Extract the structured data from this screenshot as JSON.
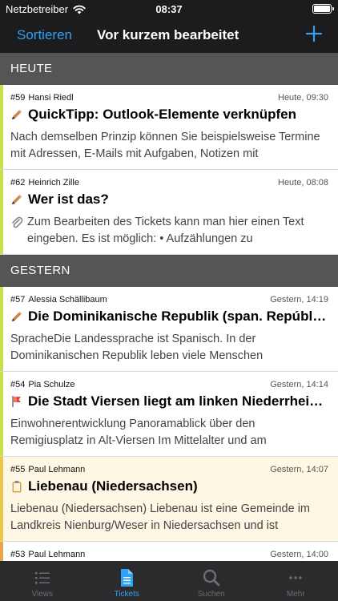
{
  "status": {
    "carrier": "Netzbetreiber",
    "time": "08:37"
  },
  "nav": {
    "sort_label": "Sortieren",
    "title": "Vor kurzem bearbeitet"
  },
  "sections": [
    {
      "label": "HEUTE"
    },
    {
      "label": "GESTERN"
    }
  ],
  "tickets": [
    {
      "number": "#59",
      "author": "Hansi Riedl",
      "timestamp": "Heute, 09:30",
      "title": "QuickTipp: Outlook-Elemente verknüpfen",
      "description": "Nach demselben Prinzip können Sie beispielsweise Termine mit Adressen, E-Mails mit Aufgaben, Notizen mit",
      "icon": "pencil-icon",
      "stripe": "#c8e04a"
    },
    {
      "number": "#62",
      "author": "Heinrich Zille",
      "timestamp": "Heute, 08:08",
      "title": "Wer ist das?",
      "description": "Zum Bearbeiten des Tickets kann man hier einen Text eingeben. Es ist möglich: • Aufzählungen zu",
      "icon": "pencil-icon",
      "stripe": "#c8e04a",
      "attachment": true
    },
    {
      "number": "#57",
      "author": "Alessia Schällibaum",
      "timestamp": "Gestern, 14:19",
      "title": "Die Dominikanische Republik (span. Repúbli…",
      "description": "SpracheDie Landessprache ist Spanisch. In der Dominikanischen Republik leben viele Menschen",
      "icon": "pencil-icon",
      "stripe": "#c8e04a"
    },
    {
      "number": "#54",
      "author": "Pia Schulze",
      "timestamp": "Gestern, 14:14",
      "title": "Die Stadt Viersen liegt am linken Niederrhei…",
      "description": "Einwohnerentwicklung Panoramablick über den Remigiusplatz in Alt-Viersen Im Mittelalter und am",
      "icon": "flag-icon",
      "stripe": "#c8e04a"
    },
    {
      "number": "#55",
      "author": "Paul Lehmann",
      "timestamp": "Gestern, 14:07",
      "title": "Liebenau (Niedersachsen)",
      "description": "Liebenau (Niedersachsen) Liebenau ist eine Gemeinde im Landkreis Nienburg/Weser in Niedersachsen und ist",
      "icon": "clipboard-icon",
      "stripe": "#e8c84a",
      "highlight": true
    },
    {
      "number": "#53",
      "author": "Paul Lehmann",
      "timestamp": "Gestern, 14:00",
      "title": "",
      "description": "",
      "icon": "",
      "stripe": "#e8a54a"
    }
  ],
  "tabs": [
    {
      "label": "Views",
      "icon": "list-icon",
      "active": false
    },
    {
      "label": "Tickets",
      "icon": "document-icon",
      "active": true
    },
    {
      "label": "Suchen",
      "icon": "search-icon",
      "active": false
    },
    {
      "label": "Mehr",
      "icon": "more-icon",
      "active": false
    }
  ],
  "colors": {
    "accent": "#2ea3f2",
    "section_bg": "#555556",
    "highlight_bg": "#fdf7e3"
  }
}
